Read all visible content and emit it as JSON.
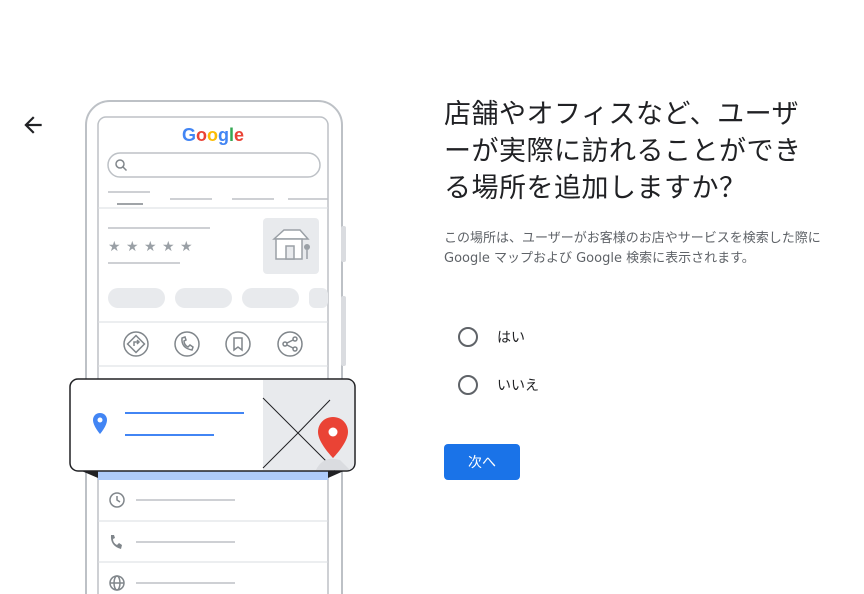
{
  "brand": {
    "logo_text": "Google"
  },
  "header": {
    "back_icon": "arrow-back-icon"
  },
  "main": {
    "heading": "店舗やオフィスなど、ユーザーが実際に訪れることができる場所を追加しますか？",
    "description": "この場所は、ユーザーがお客様のお店やサービスを検索した際に Google マップおよび Google 検索に表示されます。",
    "options": [
      {
        "label": "はい",
        "selected": false
      },
      {
        "label": "いいえ",
        "selected": false
      }
    ],
    "next_label": "次へ"
  },
  "colors": {
    "accent": "#1a73e8",
    "map_pin": "#ea4335",
    "location_pin": "#4285f4"
  }
}
